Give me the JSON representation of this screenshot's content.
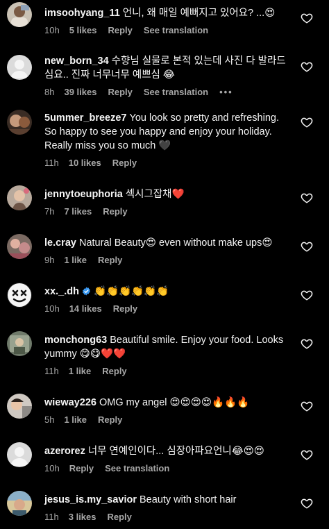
{
  "labels": {
    "reply": "Reply",
    "see_translation": "See translation",
    "more": "•••"
  },
  "comments": [
    {
      "username": "imsoohyang_11",
      "text": "언니, 왜 매일 예뻐지고 있어요? ...",
      "emoji": "😍",
      "time": "10h",
      "likes": "5 likes",
      "see_translation": true,
      "avatar_icon": "profile-photo"
    },
    {
      "username": "new_born_34",
      "text": "수향님 실물로 본적 있는데 사진 다 발라드 심요.. 진짜 너무너무 예쁘심",
      "emoji": "😂",
      "time": "8h",
      "likes": "39 likes",
      "see_translation": true,
      "more": true,
      "avatar_icon": "default-avatar"
    },
    {
      "username": "5ummer_breeze7",
      "text": "You look so pretty and refreshing. So happy to see you happy and enjoy your holiday. Really miss you so much",
      "emoji": "🖤",
      "time": "11h",
      "likes": "10 likes",
      "avatar_icon": "profile-photo"
    },
    {
      "username": "jennytoeuphoria",
      "text": "섹시그잡채",
      "emoji": "❤️",
      "time": "7h",
      "likes": "7 likes",
      "avatar_icon": "profile-photo"
    },
    {
      "username": "le.cray",
      "text": "Natural Beauty😍 even without make ups",
      "emoji": "😍",
      "time": "9h",
      "likes": "1 like",
      "avatar_icon": "profile-photo"
    },
    {
      "username": "xx._.dh",
      "verified": true,
      "text": "",
      "emoji": "👏👏👏👏👏👏",
      "time": "10h",
      "likes": "14 likes",
      "avatar_icon": "marshmello-avatar"
    },
    {
      "username": "monchong63",
      "text": "Beautiful smile. Enjoy your food. Looks yummy",
      "emoji": "😋😋❤️❤️",
      "time": "11h",
      "likes": "1 like",
      "avatar_icon": "profile-photo"
    },
    {
      "username": "wieway226",
      "text": "OMG my angel",
      "emoji": "😍😍😍😍🔥🔥🔥",
      "time": "5h",
      "likes": "1 like",
      "avatar_icon": "profile-photo"
    },
    {
      "username": "azerorez",
      "text": "너무 연예인이다... 심장아파요언니",
      "emoji": "😂😍😍",
      "time": "10h",
      "likes": "",
      "see_translation": true,
      "avatar_icon": "default-avatar"
    },
    {
      "username": "jesus_is.my_savior",
      "text": "Beauty with short hair",
      "emoji": "",
      "time": "11h",
      "likes": "3 likes",
      "avatar_icon": "profile-photo"
    }
  ],
  "colors": {
    "background": "#000000",
    "text": "#f5f5f5",
    "meta": "#a8a8a8",
    "verified": "#3897f0"
  }
}
